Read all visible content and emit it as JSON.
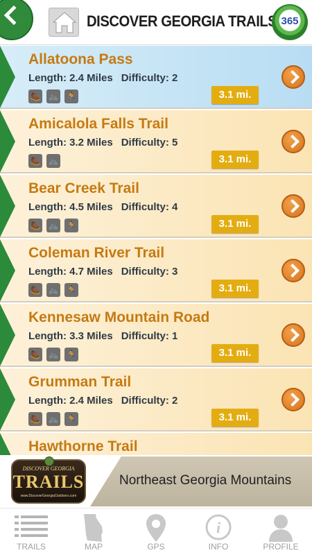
{
  "header": {
    "title": "DISCOVER GEORGIA TRAILS",
    "logo_text": "365"
  },
  "trails": [
    {
      "name": "Allatoona Pass",
      "length_label": "Length: 2.4 Miles",
      "difficulty_label": "Difficulty: 2",
      "distance": "3.1 mi.",
      "activities": [
        "hiking-icon",
        "biking-icon",
        "running-icon"
      ]
    },
    {
      "name": "Amicalola Falls Trail",
      "length_label": "Length: 3.2 Miles",
      "difficulty_label": "Difficulty: 5",
      "distance": "3.1 mi.",
      "activities": [
        "hiking-icon",
        "biking-icon"
      ]
    },
    {
      "name": "Bear Creek Trail",
      "length_label": "Length: 4.5 Miles",
      "difficulty_label": "Difficulty: 4",
      "distance": "3.1 mi.",
      "activities": [
        "hiking-icon",
        "biking-icon",
        "running-icon"
      ]
    },
    {
      "name": "Coleman River Trail",
      "length_label": "Length: 4.7 Miles",
      "difficulty_label": "Difficulty: 3",
      "distance": "3.1 mi.",
      "activities": [
        "hiking-icon",
        "biking-icon",
        "running-icon"
      ]
    },
    {
      "name": "Kennesaw Mountain Road",
      "length_label": "Length: 3.3 Miles",
      "difficulty_label": "Difficulty: 1",
      "distance": "3.1 mi.",
      "activities": [
        "hiking-icon",
        "biking-icon",
        "running-icon"
      ]
    },
    {
      "name": "Grumman Trail",
      "length_label": "Length: 2.4 Miles",
      "difficulty_label": "Difficulty: 2",
      "distance": "3.1 mi.",
      "activities": [
        "hiking-icon",
        "biking-icon",
        "running-icon"
      ]
    },
    {
      "name": "Hawthorne Trail",
      "length_label": "",
      "difficulty_label": "",
      "distance": "",
      "activities": []
    }
  ],
  "region": {
    "label": "Northeast Georgia Mountains",
    "badge_top": "DISCOVER GEORGIA",
    "badge_main": "TRAILS",
    "badge_url": "www.DiscoverGeorgiaOutdoors.com"
  },
  "nav": {
    "items": [
      {
        "label": "TRAILS",
        "icon": "list-icon"
      },
      {
        "label": "MAP",
        "icon": "georgia-map-icon"
      },
      {
        "label": "GPS",
        "icon": "location-pin-icon"
      },
      {
        "label": "INFO",
        "icon": "info-icon"
      },
      {
        "label": "PROFILE",
        "icon": "person-icon"
      }
    ]
  },
  "colors": {
    "accent_green": "#2c8a3b",
    "trail_name": "#c57a12",
    "distance_badge": "#e3ad12",
    "active_row": "#c8e6f6",
    "row_bg": "#fbe8c0"
  }
}
